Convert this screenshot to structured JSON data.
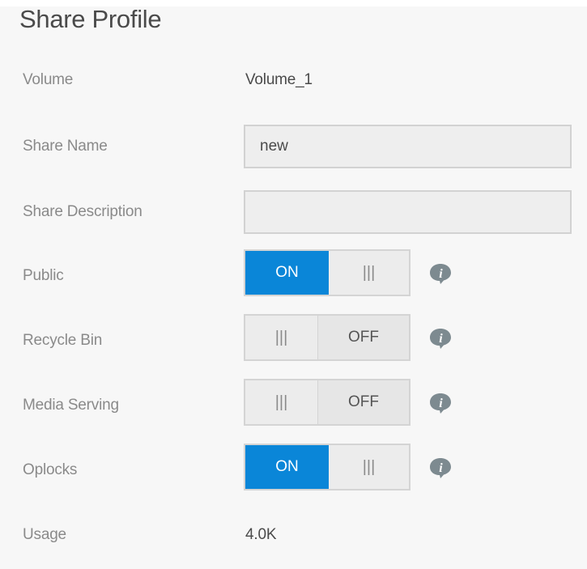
{
  "form": {
    "title": "Share Profile",
    "volume": {
      "label": "Volume",
      "value": "Volume_1"
    },
    "share_name": {
      "label": "Share Name",
      "value": "new",
      "placeholder": ""
    },
    "share_description": {
      "label": "Share Description",
      "value": "",
      "placeholder": ""
    },
    "public": {
      "label": "Public",
      "state": "ON",
      "on_text": "ON",
      "off_text": "OFF",
      "grip": "|||"
    },
    "recycle_bin": {
      "label": "Recycle Bin",
      "state": "OFF",
      "on_text": "ON",
      "off_text": "OFF",
      "grip": "|||"
    },
    "media_serving": {
      "label": "Media Serving",
      "state": "OFF",
      "on_text": "ON",
      "off_text": "OFF",
      "grip": "|||"
    },
    "oplocks": {
      "label": "Oplocks",
      "state": "ON",
      "on_text": "ON",
      "off_text": "OFF",
      "grip": "|||"
    },
    "usage": {
      "label": "Usage",
      "value": "4.0K"
    }
  },
  "icons": {
    "info": "info-icon"
  },
  "colors": {
    "accent": "#0a86d8",
    "info_icon": "#7d8a90",
    "label_text": "#8a8a8a",
    "value_text": "#4a4a4a",
    "panel_bg": "#f7f7f7"
  }
}
